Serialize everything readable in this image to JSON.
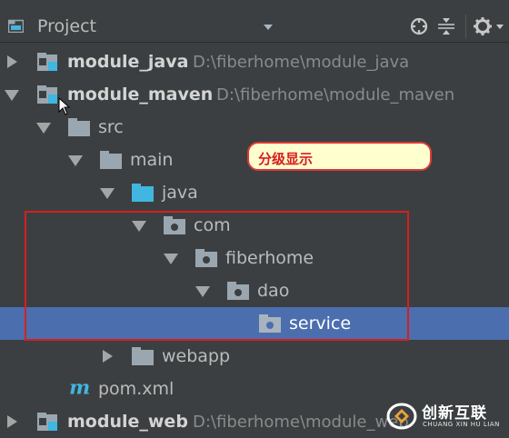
{
  "header": {
    "title": "Project",
    "icons": [
      "project-folder-icon",
      "dropdown-arrow-icon",
      "locate-target-icon",
      "collapse-all-icon",
      "gear-icon",
      "gear-menu-arrow-icon"
    ]
  },
  "tree": [
    {
      "label": "module_java",
      "path": "D:\\fiberhome\\module_java",
      "bold": true,
      "icon": "module-icon",
      "expanded": false
    },
    {
      "label": "module_maven",
      "path": "D:\\fiberhome\\module_maven",
      "bold": true,
      "icon": "module-icon",
      "expanded": true
    },
    {
      "label": "src",
      "icon": "folder-icon",
      "expanded": true
    },
    {
      "label": "main",
      "icon": "folder-icon",
      "expanded": true
    },
    {
      "label": "java",
      "icon": "source-folder-icon",
      "expanded": true
    },
    {
      "label": "com",
      "icon": "package-icon",
      "expanded": true
    },
    {
      "label": "fiberhome",
      "icon": "package-icon",
      "expanded": true
    },
    {
      "label": "dao",
      "icon": "package-icon",
      "expanded": true
    },
    {
      "label": "service",
      "icon": "package-icon",
      "selected": true
    },
    {
      "label": "webapp",
      "icon": "folder-icon",
      "expanded": false
    },
    {
      "label": "pom.xml",
      "icon": "maven-file-icon"
    },
    {
      "label": "module_web",
      "path": "D:\\fiberhome\\module_web",
      "bold": true,
      "icon": "module-icon",
      "expanded": false
    }
  ],
  "annotation": {
    "text": "分级显示"
  },
  "watermark": {
    "main": "创新互联",
    "sub": "CHUANG XIN HU LIAN"
  },
  "colors": {
    "background": "#3c3f41",
    "selection": "#4b6eaf",
    "annotation_border": "#d42020",
    "annotation_fill": "#fffecf"
  }
}
